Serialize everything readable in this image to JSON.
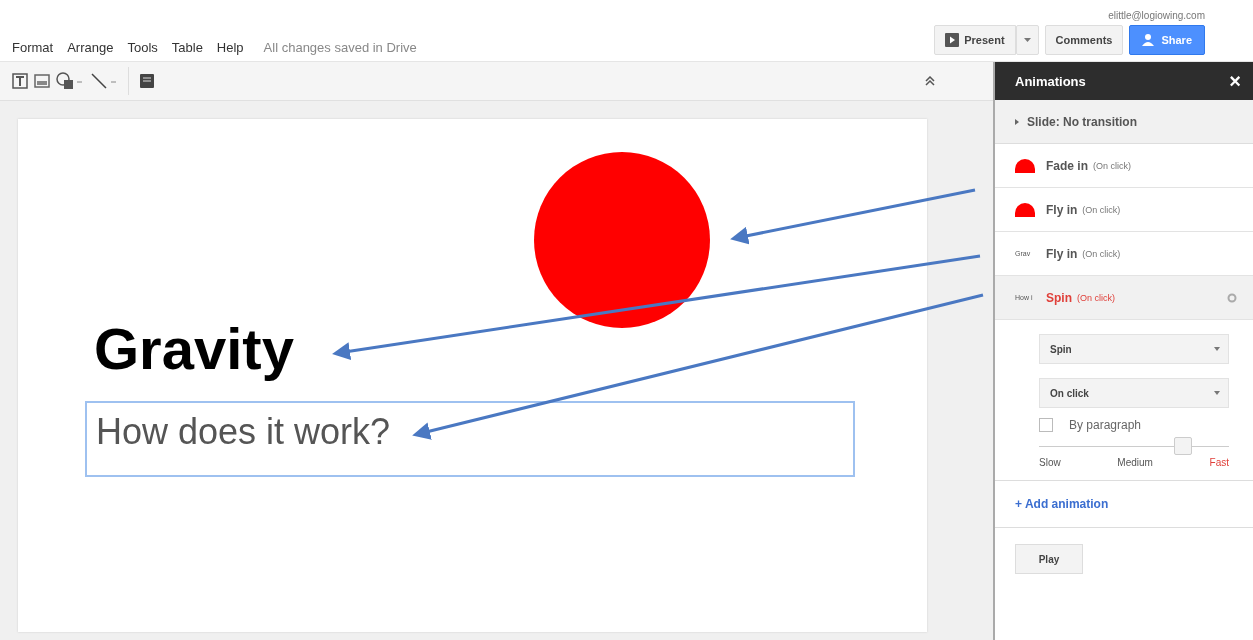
{
  "account": {
    "email": "elittle@logiowing.com"
  },
  "menu": [
    {
      "label": "Format"
    },
    {
      "label": "Arrange"
    },
    {
      "label": "Tools"
    },
    {
      "label": "Table"
    },
    {
      "label": "Help"
    }
  ],
  "save_status": "All changes saved in Drive",
  "buttons": {
    "present": "Present",
    "comments": "Comments",
    "share": "Share"
  },
  "slide": {
    "title": "Gravity",
    "subtitle": "How does it work?"
  },
  "panel": {
    "title": "Animations",
    "close": "×",
    "transition": "Slide: No transition",
    "items": [
      {
        "kind": "shape",
        "effect": "Fade in",
        "trigger": "(On click)",
        "selected": false
      },
      {
        "kind": "shape",
        "effect": "Fly in",
        "trigger": "(On click)",
        "selected": false
      },
      {
        "kind": "text",
        "thumb_text": "Grav",
        "effect": "Fly in",
        "trigger": "(On click)",
        "selected": false
      },
      {
        "kind": "text",
        "thumb_text": "How i",
        "effect": "Spin",
        "trigger": "(On click)",
        "selected": true
      }
    ],
    "effect_select": "Spin",
    "trigger_select": "On click",
    "by_paragraph": {
      "label": "By paragraph",
      "checked": false
    },
    "speed": {
      "level": 0.76,
      "labels": [
        {
          "label": "Slow",
          "selected": false
        },
        {
          "label": "Medium",
          "selected": false
        },
        {
          "label": "Fast",
          "selected": true
        }
      ]
    },
    "add_animation": "+ Add animation",
    "play": "Play"
  }
}
